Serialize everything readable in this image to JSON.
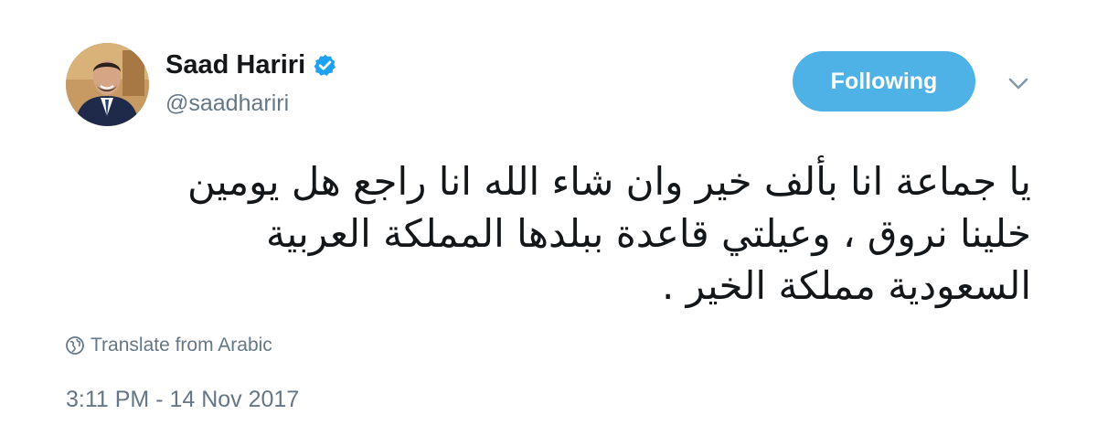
{
  "author": {
    "display_name": "Saad Hariri",
    "handle": "@saadhariri",
    "verified": true
  },
  "follow_button": {
    "label": "Following"
  },
  "tweet": {
    "text": "يا جماعة انا بألف خير   وان شاء الله انا راجع هل يومين خلينا نروق ، وعيلتي قاعدة ببلدها المملكة العربية السعودية مملكة الخير .",
    "translate_label": "Translate from Arabic",
    "timestamp": "3:11 PM - 14 Nov 2017"
  },
  "icons": {
    "verified": "verified-badge-icon",
    "caret": "chevron-down-icon",
    "translate": "globe-icon"
  },
  "colors": {
    "accent": "#4fb2e6",
    "verified": "#1da1f2",
    "secondary_text": "#657786",
    "primary_text": "#14171a"
  }
}
